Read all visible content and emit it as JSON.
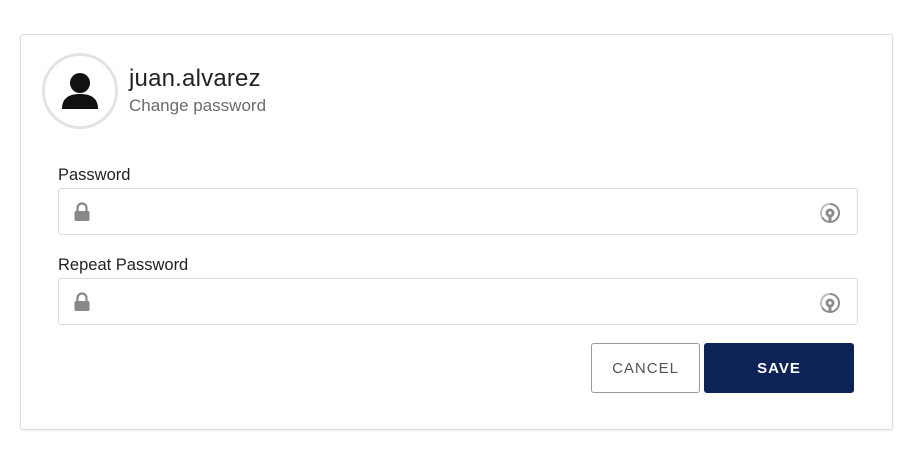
{
  "profile": {
    "username": "juan.alvarez",
    "subtitle": "Change password",
    "avatar_icon": "user-icon"
  },
  "form": {
    "password": {
      "label": "Password",
      "value": "",
      "placeholder": "",
      "leading_icon": "lock-icon",
      "trailing_icon": "reveal-password-icon"
    },
    "repeat_password": {
      "label": "Repeat Password",
      "value": "",
      "placeholder": "",
      "leading_icon": "lock-icon",
      "trailing_icon": "reveal-password-icon"
    }
  },
  "actions": {
    "cancel_label": "CANCEL",
    "save_label": "SAVE"
  },
  "colors": {
    "primary": "#0d2358",
    "border": "#dcdcdc",
    "icon": "#888888",
    "text": "#222222",
    "muted_text": "#6b6b6b"
  }
}
